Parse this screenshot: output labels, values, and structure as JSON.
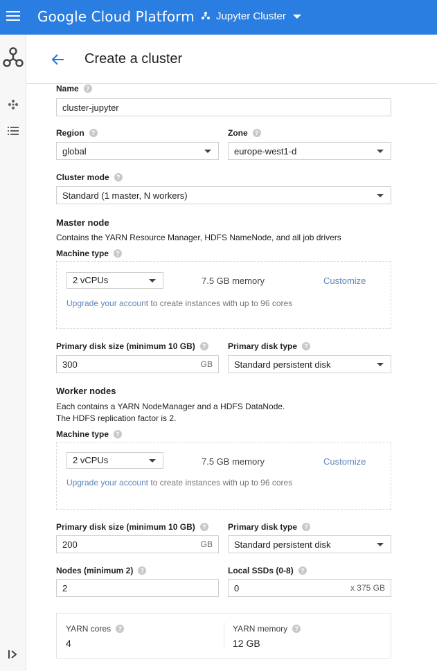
{
  "topbar": {
    "brand": "Google Cloud Platform",
    "project": "Jupyter Cluster"
  },
  "header": {
    "title": "Create a cluster"
  },
  "form": {
    "name": {
      "label": "Name",
      "value": "cluster-jupyter"
    },
    "region": {
      "label": "Region",
      "value": "global"
    },
    "zone": {
      "label": "Zone",
      "value": "europe-west1-d"
    },
    "cluster_mode": {
      "label": "Cluster mode",
      "value": "Standard (1 master, N workers)"
    },
    "master": {
      "title": "Master node",
      "description": "Contains the YARN Resource Manager, HDFS NameNode, and all job drivers",
      "machine_type_label": "Machine type",
      "vcpus": "2 vCPUs",
      "memory": "7.5 GB memory",
      "customize": "Customize",
      "upgrade_link": "Upgrade your account",
      "upgrade_rest": " to create instances with up to 96 cores",
      "disk_size_label": "Primary disk size (minimum 10 GB)",
      "disk_size_value": "300",
      "disk_unit": "GB",
      "disk_type_label": "Primary disk type",
      "disk_type_value": "Standard persistent disk"
    },
    "worker": {
      "title": "Worker nodes",
      "description_1": "Each contains a YARN NodeManager and a HDFS DataNode.",
      "description_2": "The HDFS replication factor is 2.",
      "machine_type_label": "Machine type",
      "vcpus": "2 vCPUs",
      "memory": "7.5 GB memory",
      "customize": "Customize",
      "upgrade_link": "Upgrade your account",
      "upgrade_rest": " to create instances with up to 96 cores",
      "disk_size_label": "Primary disk size (minimum 10 GB)",
      "disk_size_value": "200",
      "disk_unit": "GB",
      "disk_type_label": "Primary disk type",
      "disk_type_value": "Standard persistent disk",
      "nodes_label": "Nodes (minimum 2)",
      "nodes_value": "2",
      "ssd_label": "Local SSDs (0-8)",
      "ssd_value": "0",
      "ssd_suffix": "x 375 GB"
    },
    "summary": {
      "yarn_cores_label": "YARN cores",
      "yarn_cores_value": "4",
      "yarn_memory_label": "YARN memory",
      "yarn_memory_value": "12 GB"
    }
  },
  "icons": {
    "menu": "hamburger-icon",
    "project": "project-dots-icon",
    "product": "dataproc-icon",
    "clusters": "clusters-icon",
    "jobs": "list-icon",
    "expand": "expand-rail-icon",
    "back": "arrow-back-icon",
    "help": "help-icon"
  },
  "colors": {
    "topbar": "#2a7de1",
    "link": "#5f86bb",
    "back_arrow": "#1a73e8"
  }
}
